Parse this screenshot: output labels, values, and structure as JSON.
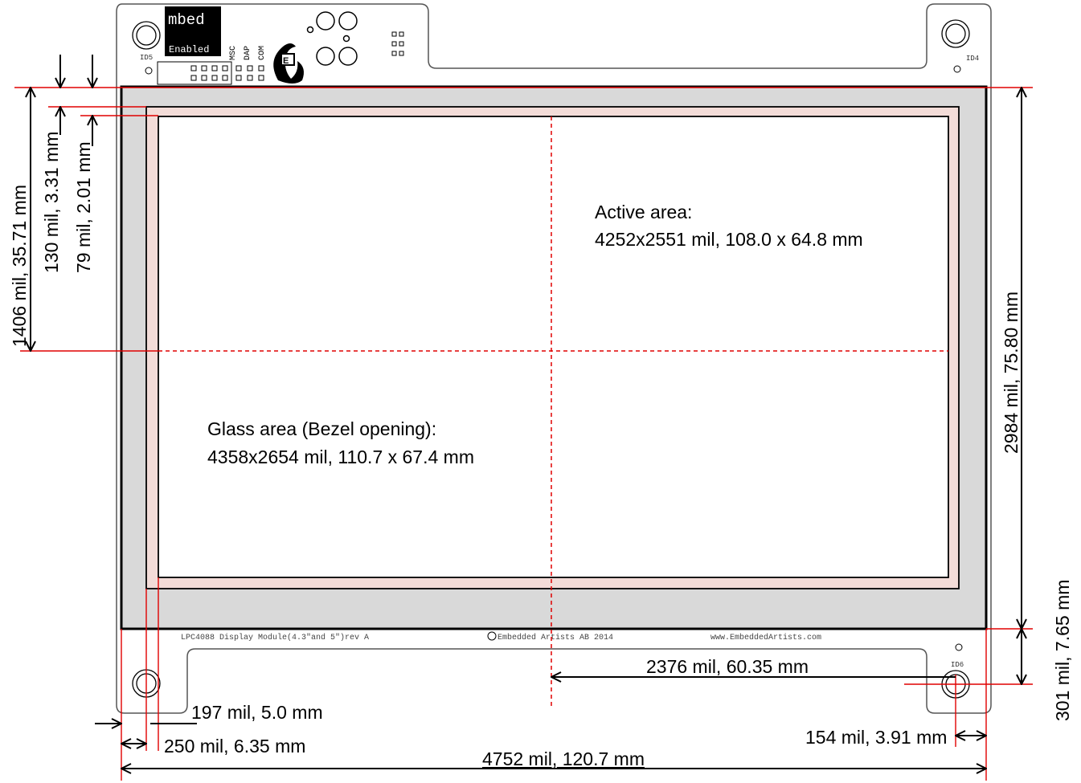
{
  "pcb_labels": {
    "mbed_logo": "mbed",
    "mbed_logo_sub": "Enabled",
    "header_labels": [
      "MSC",
      "DAP",
      "COM"
    ],
    "id_top_left": "ID5",
    "id_top_right": "ID4",
    "id_bottom_right": "ID6",
    "module_name": "LPC4088 Display Module(4.3\"and 5\")rev A",
    "copyright": "Embedded Artists AB 2014",
    "website": "www.EmbeddedArtists.com"
  },
  "annotations": {
    "active_area_title": "Active area:",
    "active_area_value": "4252x2551 mil, 108.0 x 64.8 mm",
    "glass_area_title": "Glass area (Bezel opening):",
    "glass_area_value": "4358x2654 mil, 110.7 x 67.4 mm"
  },
  "dimensions": {
    "total_width": "4752 mil, 120.7 mm",
    "left_to_glass": "250 mil, 6.35 mm",
    "left_to_active": "197 mil, 5.0 mm",
    "hole_offset_right": "154 mil, 3.91 mm",
    "hole_center_x": "2376 mil, 60.35 mm",
    "bottom_to_hole": "301 mil, 7.65 mm",
    "panel_height": "2984 mil, 75.80 mm",
    "top_to_center": "1406 mil, 35.71 mm",
    "top_to_glass": "130 mil, 3.31 mm",
    "top_to_active": "79 mil, 2.01 mm"
  },
  "colors": {
    "outline": "#000000",
    "dimension_line": "#e00000",
    "bezel": "#d9d9d9",
    "glass": "#f3dcd8",
    "board_edge": "#555555"
  }
}
